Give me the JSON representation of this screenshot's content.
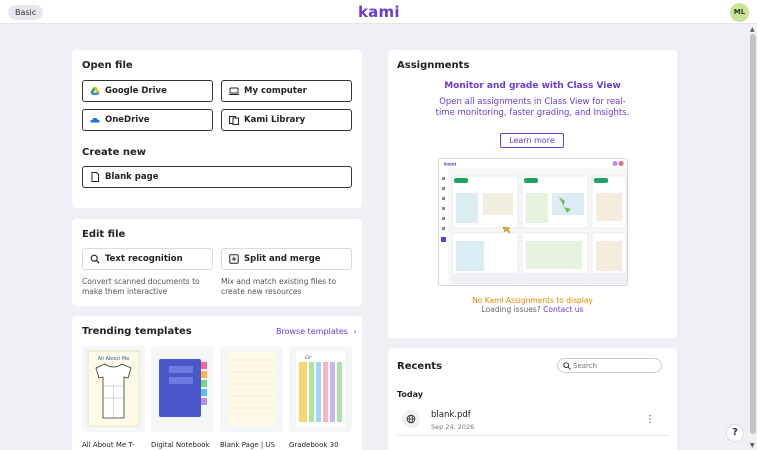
{
  "header": {
    "mode_label": "Basic",
    "logo_text": "kami",
    "avatar_initials": "ML"
  },
  "open_file": {
    "title": "Open file",
    "buttons": {
      "google_drive": "Google Drive",
      "my_computer": "My computer",
      "onedrive": "OneDrive",
      "kami_library": "Kami Library"
    }
  },
  "create_new": {
    "title": "Create new",
    "blank_page": "Blank page"
  },
  "edit_file": {
    "title": "Edit file",
    "text_recognition": "Text recognition",
    "text_recognition_desc": "Convert scanned documents to make them interactive",
    "split_merge": "Split and merge",
    "split_merge_desc": "Mix and match existing files to create new resources"
  },
  "templates": {
    "title": "Trending templates",
    "browse": "Browse templates",
    "items": [
      {
        "name": "All About Me T-"
      },
      {
        "name": "Digital Notebook"
      },
      {
        "name": "Blank Page | US"
      },
      {
        "name": "Gradebook 30"
      }
    ]
  },
  "assignments": {
    "title": "Assignments",
    "headline": "Monitor and grade with Class View",
    "subtext": "Open all assignments in Class View for real-time monitoring, faster grading, and Insights.",
    "learn_more": "Learn more",
    "no_assignments": "No Kami Assignments to display",
    "loading_issues": "Loading issues?",
    "contact_us": "Contact us",
    "preview_logo": "kami"
  },
  "recents": {
    "title": "Recents",
    "search_placeholder": "Search",
    "group_label": "Today",
    "files": [
      {
        "name": "blank.pdf",
        "date": "Sep 24, 2026"
      }
    ]
  },
  "colors": {
    "brand": "#6b3bd6",
    "warning": "#e08a00",
    "background": "#eef0f5"
  }
}
